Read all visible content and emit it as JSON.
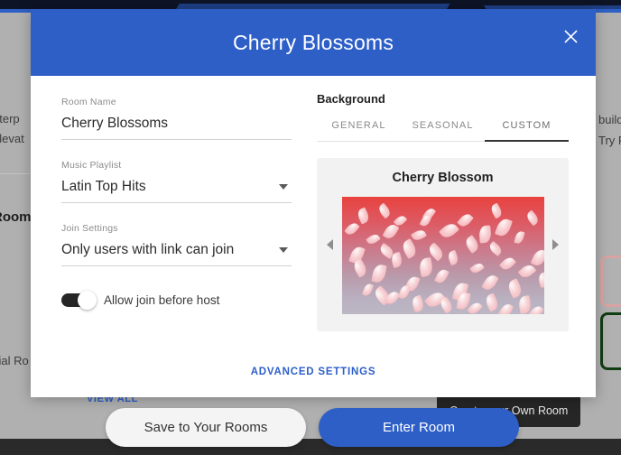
{
  "modal": {
    "title": "Cherry Blossoms",
    "close_icon": "close-icon",
    "form": {
      "room_name": {
        "label": "Room Name",
        "value": "Cherry Blossoms",
        "placeholder": "Room Name"
      },
      "music_playlist": {
        "label": "Music Playlist",
        "value": "Latin Top Hits"
      },
      "join_settings": {
        "label": "Join Settings",
        "value": "Only users with link can join"
      },
      "allow_join_before_host": {
        "label": "Allow join before host",
        "enabled": true
      }
    },
    "background": {
      "section_title": "Background",
      "tabs": [
        {
          "label": "GENERAL",
          "active": false
        },
        {
          "label": "SEASONAL",
          "active": false
        },
        {
          "label": "CUSTOM",
          "active": true
        }
      ],
      "carousel": {
        "item_title": "Cherry Blossom",
        "prev_icon": "chevron-left-icon",
        "next_icon": "chevron-right-icon"
      }
    },
    "advanced_settings_label": "ADVANCED SETTINGS"
  },
  "footer": {
    "save_label": "Save to Your Rooms",
    "enter_label": "Enter Room"
  },
  "background_page": {
    "text_left_1": "nterp",
    "text_left_2": "elevat",
    "text_left_heading": "Room",
    "text_left_3": "cial Ro",
    "text_right_1": "build",
    "text_right_2": "Try F",
    "view_all_label": "VIEW ALL",
    "tooltip_label": "Create your Own Room"
  },
  "colors": {
    "accent_blue": "#2d5fc7",
    "header_blue": "#2d5fc7",
    "toggle_on": "#262626",
    "card_gray": "#f2f2f2",
    "overlay_gray": "#b0b0b0",
    "preview_top": "#e8423e",
    "preview_bottom": "#bcb6c4"
  }
}
